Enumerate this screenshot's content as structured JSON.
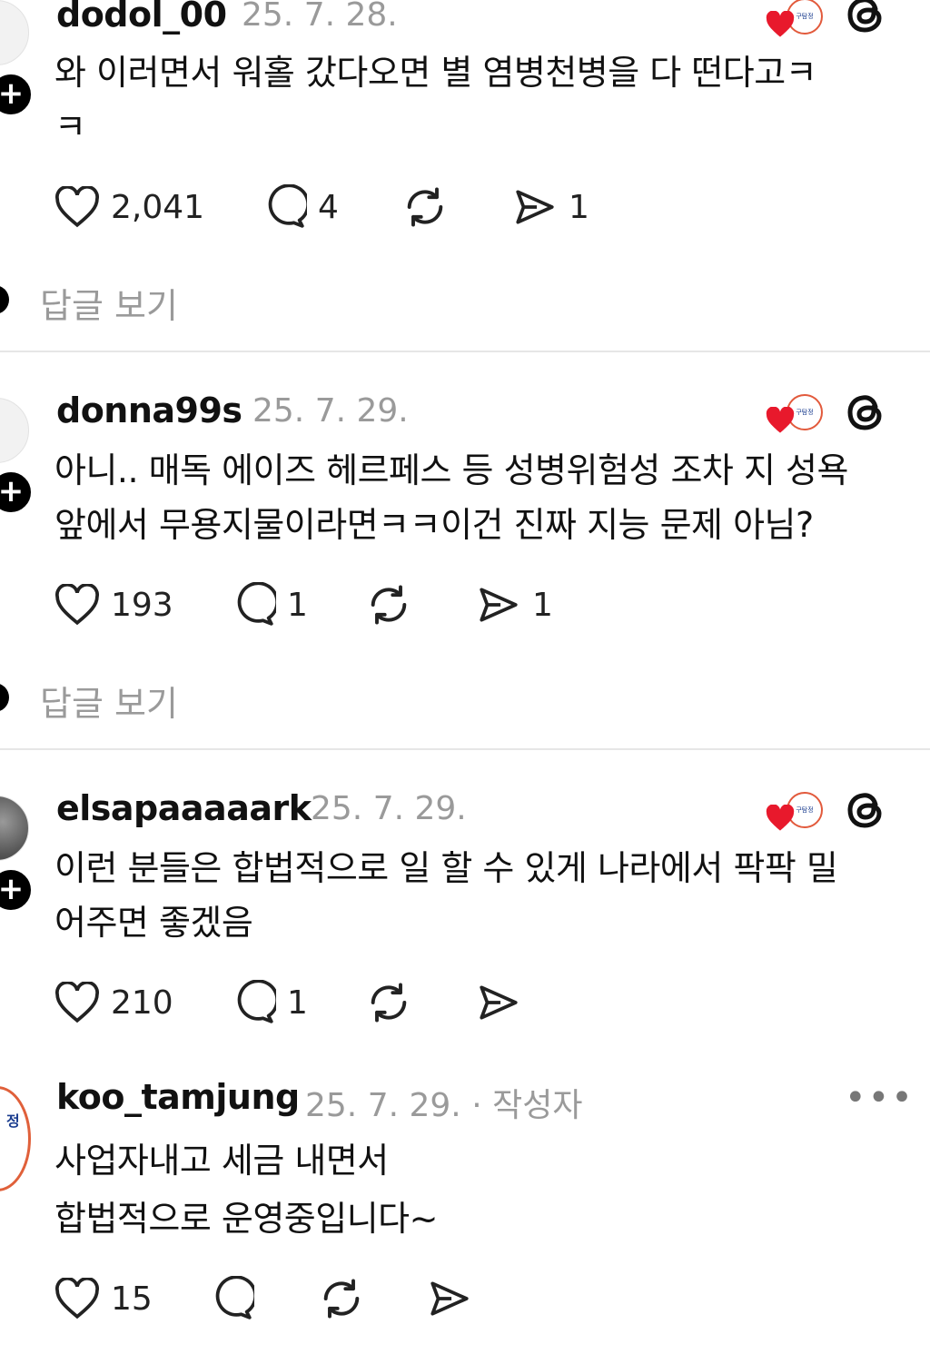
{
  "comments": [
    {
      "username": "dodol_00",
      "date": "25. 7. 28.",
      "text_line1": "와 이러면서 워홀 갔다오면 별 염병천병을 다 떤다고ㅋ",
      "text_line2": "ㅋ",
      "likes": "2,041",
      "comments": "4",
      "shares": "1",
      "replies_label": "답글 보기"
    },
    {
      "username": "donna99s",
      "date": "25. 7. 29.",
      "text_line1": "아니.. 매독 에이즈 헤르페스 등 성병위험성 조차 지 성욕",
      "text_line2": "앞에서 무용지물이라면ㅋㅋ이건 진짜 지능 문제 아님?",
      "likes": "193",
      "comments": "1",
      "shares": "1",
      "replies_label": "답글 보기"
    },
    {
      "username": "elsapaaaaark",
      "date": "25. 7. 29.",
      "text_line1": "이런 분들은 합법적으로 일 할 수 있게 나라에서 팍팍 밀",
      "text_line2": "어주면 좋겠음",
      "likes": "210",
      "comments": "1"
    },
    {
      "username": "koo_tamjung",
      "date": "25. 7. 29.",
      "author_tag": "· 작성자",
      "text_line1": "사업자내고 세금 내면서",
      "text_line2": "합법적으로 운영중입니다~",
      "likes": "15",
      "more_label": "•••"
    }
  ],
  "avatar_partial_text": "정",
  "colors": {
    "heart": "#e8192c",
    "muted": "#9a9a9a",
    "divider": "#e6e6e6"
  }
}
